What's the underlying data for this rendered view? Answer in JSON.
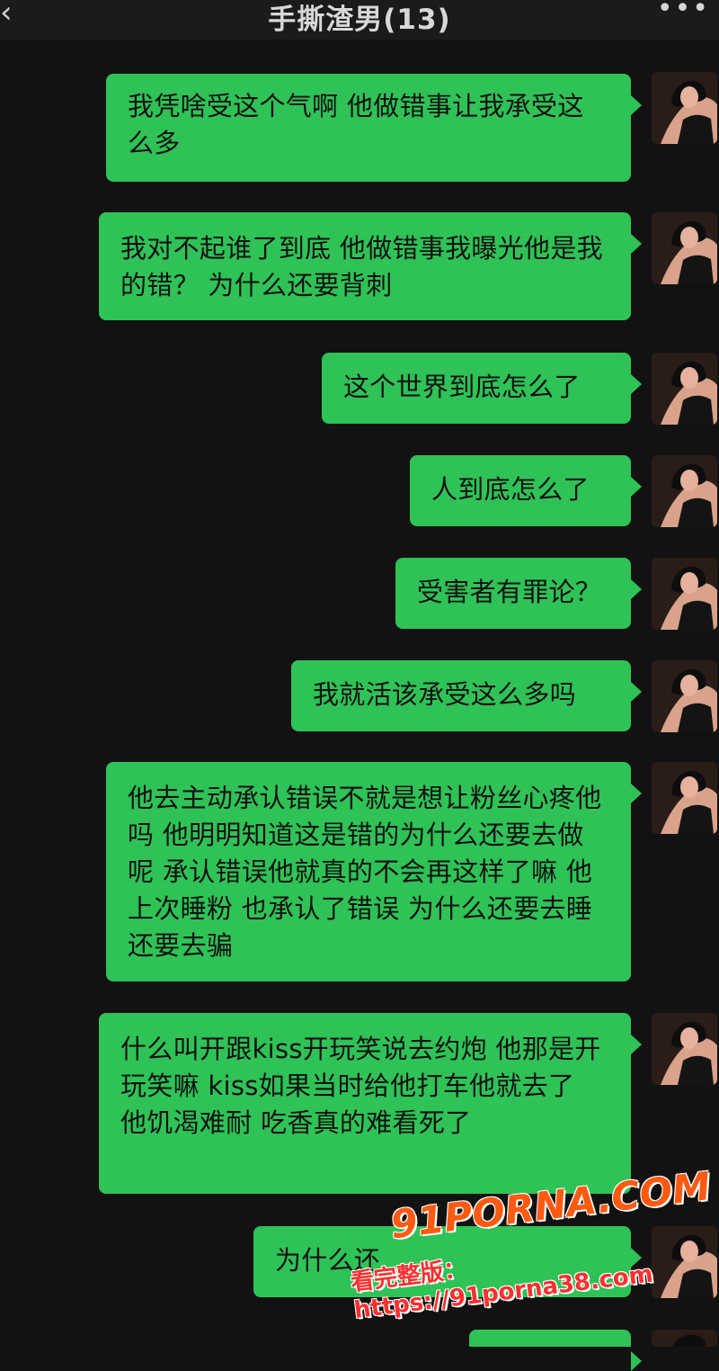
{
  "header": {
    "back_icon": "chevron-left-icon",
    "title": "手撕渣男(13)",
    "more_icon": "more-icon"
  },
  "messages": [
    {
      "text": "我凭啥受这个气啊 他做错事让我承受这么多"
    },
    {
      "text": "我对不起谁了到底 他做错事我曝光他是我的错？ 为什么还要背刺"
    },
    {
      "text": "这个世界到底怎么了"
    },
    {
      "text": "人到底怎么了"
    },
    {
      "text": "受害者有罪论？"
    },
    {
      "text": "我就活该承受这么多吗"
    },
    {
      "text": "他去主动承认错误不就是想让粉丝心疼他吗 他明明知道这是错的为什么还要去做呢 承认错误他就真的不会再这样了嘛 他上次睡粉 也承认了错误 为什么还要去睡还要去骗"
    },
    {
      "text": "什么叫开跟kiss开玩笑说去约炮 他那是开玩笑嘛 kiss如果当时给他打车他就去了 他饥渴难耐 吃香真的难看死了"
    },
    {
      "text": "为什么还"
    }
  ],
  "watermark": {
    "brand": "91PORNA.COM",
    "url": "看完整版：https://91porna38.com"
  },
  "colors": {
    "background": "#121212",
    "bubble": "#2fc257",
    "watermark_brand": "#ff5a12",
    "watermark_url": "#ff2f2f"
  }
}
